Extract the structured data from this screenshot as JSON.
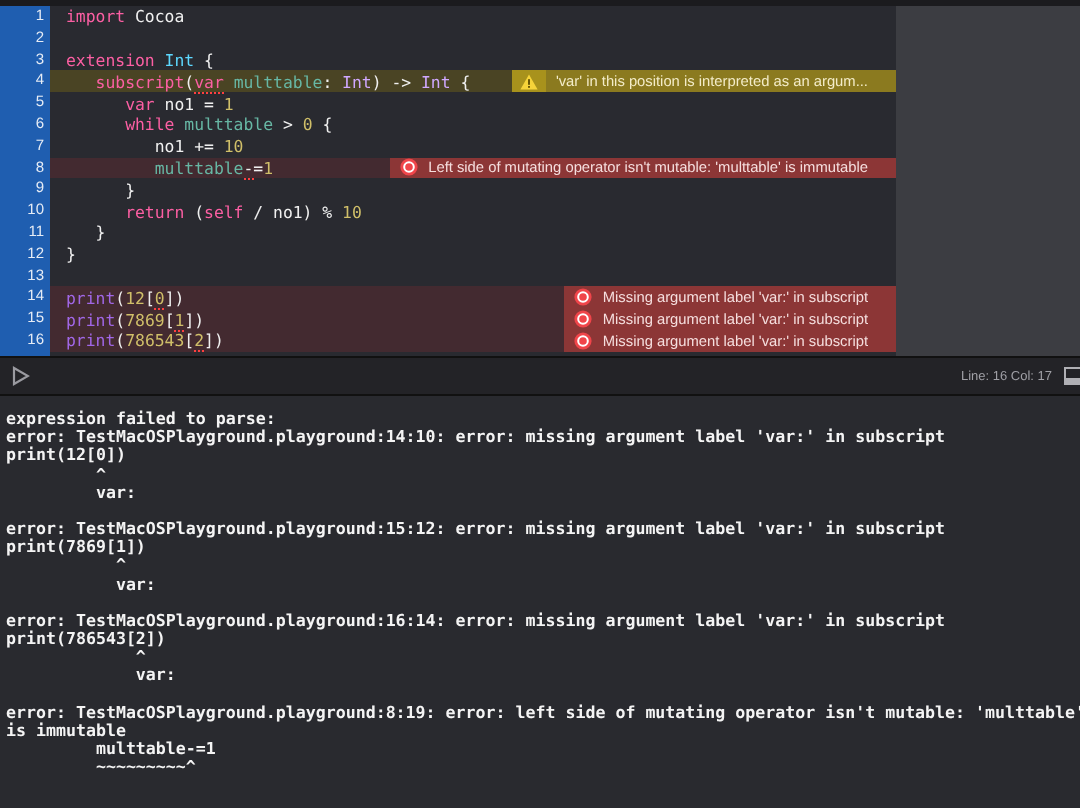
{
  "editor": {
    "lines": [
      {
        "number": "1",
        "kind": "plain",
        "tokens": [
          {
            "text": "import",
            "kind": "keyword",
            "flagged": false
          },
          {
            "text": " Cocoa",
            "kind": "plain",
            "flagged": false
          }
        ]
      },
      {
        "number": "2",
        "kind": "plain"
      },
      {
        "number": "3",
        "kind": "plain",
        "tokens": [
          {
            "text": "extension",
            "kind": "keyword",
            "flagged": false
          },
          {
            "text": " Int",
            "kind": "type",
            "flagged": false
          },
          {
            "text": " {",
            "kind": "plain",
            "flagged": false
          }
        ]
      },
      {
        "number": "4",
        "kind": "warning",
        "message": "'var' in this position is interpreted as an argum...",
        "tokens": [
          {
            "text": "   subscript",
            "kind": "keyword",
            "flagged": false
          },
          {
            "text": "(",
            "kind": "plain",
            "flagged": false
          },
          {
            "text": "var",
            "kind": "keyword",
            "flagged": true
          },
          {
            "text": " multtable",
            "kind": "ident",
            "flagged": false
          },
          {
            "text": ": ",
            "kind": "plain",
            "flagged": false
          },
          {
            "text": "Int",
            "kind": "type-ref",
            "flagged": false
          },
          {
            "text": ") -> ",
            "kind": "plain",
            "flagged": false
          },
          {
            "text": "Int",
            "kind": "type-ref",
            "flagged": false
          },
          {
            "text": " {",
            "kind": "plain",
            "flagged": false
          }
        ]
      },
      {
        "number": "5",
        "kind": "plain",
        "tokens": [
          {
            "text": "      var",
            "kind": "keyword",
            "flagged": false
          },
          {
            "text": " no1 = ",
            "kind": "plain",
            "flagged": false
          },
          {
            "text": "1",
            "kind": "number",
            "flagged": false
          }
        ]
      },
      {
        "number": "6",
        "kind": "plain",
        "tokens": [
          {
            "text": "      while",
            "kind": "keyword",
            "flagged": false
          },
          {
            "text": " multtable",
            "kind": "ident",
            "flagged": false
          },
          {
            "text": " > ",
            "kind": "plain",
            "flagged": false
          },
          {
            "text": "0",
            "kind": "number",
            "flagged": false
          },
          {
            "text": " {",
            "kind": "plain",
            "flagged": false
          }
        ]
      },
      {
        "number": "7",
        "kind": "plain",
        "tokens": [
          {
            "text": "         no1 += ",
            "kind": "plain",
            "flagged": false
          },
          {
            "text": "10",
            "kind": "number",
            "flagged": false
          }
        ]
      },
      {
        "number": "8",
        "kind": "error",
        "message": "Left side of mutating operator isn't mutable: 'multtable' is immutable",
        "tokens": [
          {
            "text": "         multtable",
            "kind": "ident",
            "flagged": false
          },
          {
            "text": "-",
            "kind": "plain",
            "flagged": true
          },
          {
            "text": "=",
            "kind": "plain",
            "flagged": false
          },
          {
            "text": "1",
            "kind": "number",
            "flagged": false
          }
        ]
      },
      {
        "number": "9",
        "kind": "plain",
        "tokens": [
          {
            "text": "      }",
            "kind": "plain",
            "flagged": false
          }
        ]
      },
      {
        "number": "10",
        "kind": "plain",
        "tokens": [
          {
            "text": "      return",
            "kind": "keyword",
            "flagged": false
          },
          {
            "text": " (",
            "kind": "plain",
            "flagged": false
          },
          {
            "text": "self",
            "kind": "keyword",
            "flagged": false
          },
          {
            "text": " / no1) % ",
            "kind": "plain",
            "flagged": false
          },
          {
            "text": "10",
            "kind": "number",
            "flagged": false
          }
        ]
      },
      {
        "number": "11",
        "kind": "plain",
        "tokens": [
          {
            "text": "   }",
            "kind": "plain",
            "flagged": false
          }
        ]
      },
      {
        "number": "12",
        "kind": "plain",
        "tokens": [
          {
            "text": "}",
            "kind": "plain",
            "flagged": false
          }
        ]
      },
      {
        "number": "13",
        "kind": "plain"
      },
      {
        "number": "14",
        "kind": "error",
        "message": "Missing argument label 'var:' in subscript",
        "tokens": [
          {
            "text": "print",
            "kind": "func",
            "flagged": false
          },
          {
            "text": "(",
            "kind": "plain",
            "flagged": false
          },
          {
            "text": "12",
            "kind": "number",
            "flagged": false
          },
          {
            "text": "[",
            "kind": "plain",
            "flagged": false
          },
          {
            "text": "0",
            "kind": "number",
            "flagged": true
          },
          {
            "text": "])",
            "kind": "plain",
            "flagged": false
          }
        ]
      },
      {
        "number": "15",
        "kind": "error",
        "message": "Missing argument label 'var:' in subscript",
        "tokens": [
          {
            "text": "print",
            "kind": "func",
            "flagged": false
          },
          {
            "text": "(",
            "kind": "plain",
            "flagged": false
          },
          {
            "text": "7869",
            "kind": "number",
            "flagged": false
          },
          {
            "text": "[",
            "kind": "plain",
            "flagged": false
          },
          {
            "text": "1",
            "kind": "number",
            "flagged": true
          },
          {
            "text": "])",
            "kind": "plain",
            "flagged": false
          }
        ]
      },
      {
        "number": "16",
        "kind": "error",
        "message": "Missing argument label 'var:' in subscript",
        "tokens": [
          {
            "text": "print",
            "kind": "func",
            "flagged": false
          },
          {
            "text": "(",
            "kind": "plain",
            "flagged": false
          },
          {
            "text": "786543",
            "kind": "number",
            "flagged": false
          },
          {
            "text": "[",
            "kind": "plain",
            "flagged": false
          },
          {
            "text": "2",
            "kind": "number",
            "flagged": true
          },
          {
            "text": "])",
            "kind": "plain",
            "flagged": false
          }
        ]
      }
    ]
  },
  "debug_bar": {
    "position": "Line: 16  Col: 17"
  },
  "console": {
    "blocks": [
      [
        "expression failed to parse:",
        "error: TestMacOSPlayground.playground:14:10: error: missing argument label 'var:' in subscript",
        "print(12[0])",
        "         ^",
        "         var:"
      ],
      [
        "error: TestMacOSPlayground.playground:15:12: error: missing argument label 'var:' in subscript",
        "print(7869[1])",
        "           ^",
        "           var:"
      ],
      [
        "error: TestMacOSPlayground.playground:16:14: error: missing argument label 'var:' in subscript",
        "print(786543[2])",
        "             ^",
        "             var:"
      ],
      [
        "error: TestMacOSPlayground.playground:8:19: error: left side of mutating operator isn't mutable: 'multtable'",
        "is immutable",
        "         multtable-=1",
        "         ~~~~~~~~~^"
      ]
    ]
  }
}
